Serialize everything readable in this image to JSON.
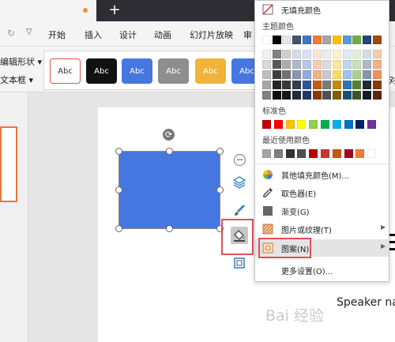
{
  "toolbar": {
    "redo_icon": "redo-icon",
    "menu_tabs": [
      "开始",
      "插入",
      "设计",
      "动画",
      "幻灯片放映",
      "审"
    ]
  },
  "ribbon": {
    "edit_shape_label": "编辑形状",
    "text_box_label": "文本框",
    "shape_styles": [
      {
        "label": "Abc",
        "bg": "#ffffff",
        "fg": "#333333",
        "border": "#e05050"
      },
      {
        "label": "Abc",
        "bg": "#111111",
        "fg": "#ffffff",
        "border": "#111111"
      },
      {
        "label": "Abc",
        "bg": "#4677e0",
        "fg": "#ffffff",
        "border": "#4677e0"
      },
      {
        "label": "Abc",
        "bg": "#8e8e8e",
        "fg": "#ffffff",
        "border": "#8e8e8e"
      },
      {
        "label": "Abc",
        "bg": "#f0b43a",
        "fg": "#ffffff",
        "border": "#f0b43a"
      },
      {
        "label": "Abc",
        "bg": "#4677e0",
        "fg": "#ffffff",
        "border": "#4677e0"
      }
    ],
    "side_label": "对"
  },
  "colors": {
    "accent_orange": "#e8763a",
    "shape_fill": "#4677e0",
    "highlight_red": "#e0505a"
  },
  "float_toolbar": {
    "icons": [
      "collapse-icon",
      "layers-icon",
      "brush-icon",
      "fill-bucket-icon",
      "outline-icon"
    ]
  },
  "slide": {
    "speaker_text": "Speaker na",
    "watermark": "Bai 经验"
  },
  "color_menu": {
    "no_fill": "无填充颜色",
    "theme_title": "主题颜色",
    "standard_title": "标准色",
    "recent_title": "最近使用颜色",
    "theme_top": [
      "#ffffff",
      "#000000",
      "#e7e6e6",
      "#44546a",
      "#4472c4",
      "#ed7d31",
      "#a5a5a5",
      "#ffc000",
      "#5b9bd5",
      "#70ad47",
      "#264478",
      "#9e480e"
    ],
    "theme_rows": [
      [
        "#f2f2f2",
        "#7f7f7f",
        "#d0cece",
        "#d6dce4",
        "#dae3f3",
        "#fbe5d6",
        "#ededed",
        "#fff2cc",
        "#deebf7",
        "#e2f0d9",
        "#d5dce4",
        "#f8cbad"
      ],
      [
        "#d9d9d9",
        "#595959",
        "#aeabab",
        "#adb9ca",
        "#b4c7e7",
        "#f8cbad",
        "#dbdbdb",
        "#ffe699",
        "#bdd7ee",
        "#c5e0b4",
        "#adb9ca",
        "#f4b183"
      ],
      [
        "#bfbfbf",
        "#3f3f3f",
        "#757171",
        "#8497b0",
        "#8faadc",
        "#f4b183",
        "#c9c9c9",
        "#ffd966",
        "#9dc3e6",
        "#a9d18e",
        "#8497b0",
        "#f08f5a"
      ],
      [
        "#a6a6a6",
        "#262626",
        "#3a3838",
        "#333f50",
        "#2f5597",
        "#c55a11",
        "#7b7b7b",
        "#bf9000",
        "#2e75b6",
        "#548235",
        "#222a35",
        "#843c0c"
      ],
      [
        "#808080",
        "#0d0d0d",
        "#171616",
        "#222a35",
        "#203864",
        "#843c0c",
        "#525252",
        "#7f6000",
        "#1f4e79",
        "#385723",
        "#161c24",
        "#5a2808"
      ]
    ],
    "standard": [
      "#c00000",
      "#ff0000",
      "#ffc000",
      "#ffff00",
      "#92d050",
      "#00b050",
      "#00b0f0",
      "#0070c0",
      "#002060",
      "#7030a0"
    ],
    "recent": [
      "#a5a5a5",
      "#7f7f7f",
      "#333333",
      "#4f4f4f",
      "#c00000",
      "#c0392b",
      "#c45a11",
      "#a50021",
      "#ed7d31",
      "#ffffff"
    ],
    "items": [
      {
        "label": "其他填充颜色(M)...",
        "icon": "color-palette-icon",
        "submenu": false
      },
      {
        "label": "取色器(E)",
        "icon": "eyedropper-icon",
        "submenu": false
      },
      {
        "label": "渐变(G)",
        "icon": "gradient-icon",
        "submenu": false
      },
      {
        "label": "图片或纹理(T)",
        "icon": "texture-icon",
        "submenu": true
      },
      {
        "label": "图案(N)",
        "icon": "pattern-icon",
        "submenu": true
      },
      {
        "label": "更多设置(O)...",
        "icon": "",
        "submenu": false
      }
    ]
  }
}
